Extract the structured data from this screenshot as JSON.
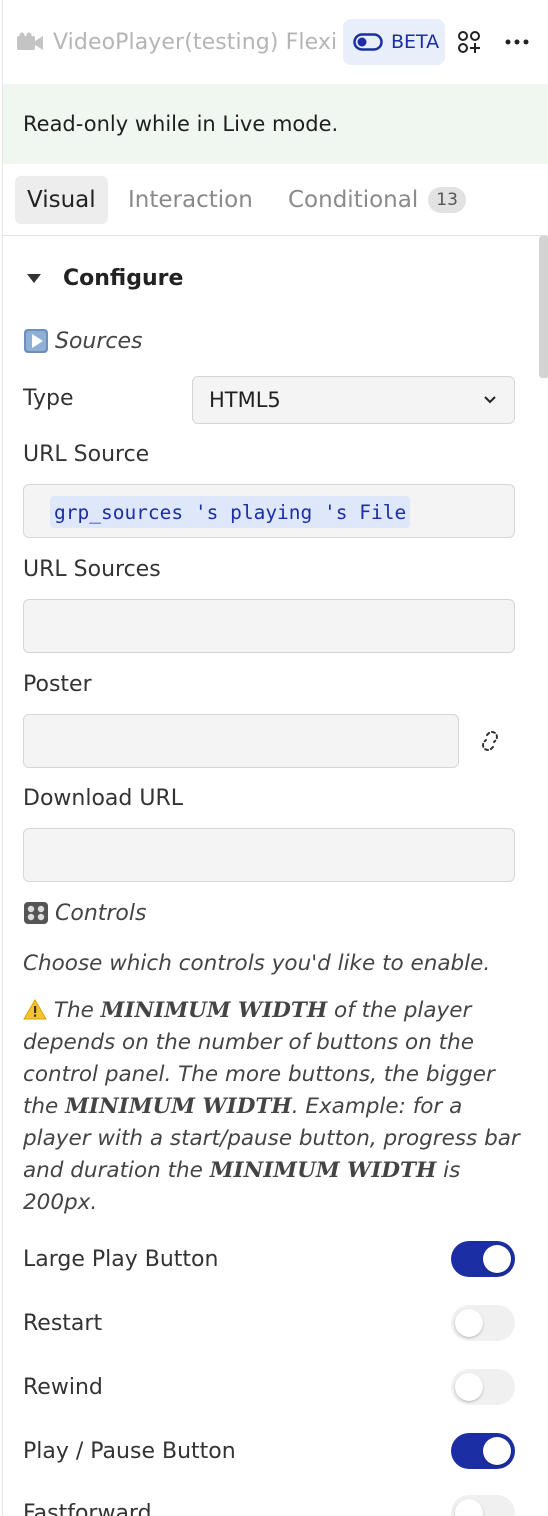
{
  "header": {
    "title": "VideoPlayer(testing) Flexi",
    "icon": "video-camera-icon",
    "beta_label": "BETA",
    "accent": "#1b2ea3"
  },
  "banner": {
    "text": "Read-only while in Live mode."
  },
  "tabs": [
    {
      "label": "Visual",
      "active": true
    },
    {
      "label": "Interaction",
      "active": false
    },
    {
      "label": "Conditional",
      "count": "13",
      "active": false
    }
  ],
  "section": {
    "title": "Configure"
  },
  "sources": {
    "heading": "Sources",
    "type_label": "Type",
    "type_value": "HTML5",
    "url_source_label": "URL Source",
    "url_source_value": "grp_sources 's playing 's File",
    "url_sources_label": "URL Sources",
    "url_sources_value": "",
    "poster_label": "Poster",
    "poster_value": "",
    "download_label": "Download URL",
    "download_value": ""
  },
  "controls": {
    "heading": "Controls",
    "intro": "Choose which controls you'd like to enable.",
    "warning": {
      "t1": " The ",
      "b1": "MINIMUM WIDTH",
      "t2": " of the player depends on the number of buttons on the control panel. The more buttons, the bigger the ",
      "b2": "MINIMUM WIDTH",
      "t3": ". Example: for a player with a start/pause button, progress bar and duration the ",
      "b3": "MINIMUM WIDTH",
      "t4": " is 200px."
    },
    "toggles": [
      {
        "label": "Large Play Button",
        "on": true
      },
      {
        "label": "Restart",
        "on": false
      },
      {
        "label": "Rewind",
        "on": false
      },
      {
        "label": "Play / Pause Button",
        "on": true
      },
      {
        "label": "Fastforward",
        "on": false
      }
    ]
  }
}
